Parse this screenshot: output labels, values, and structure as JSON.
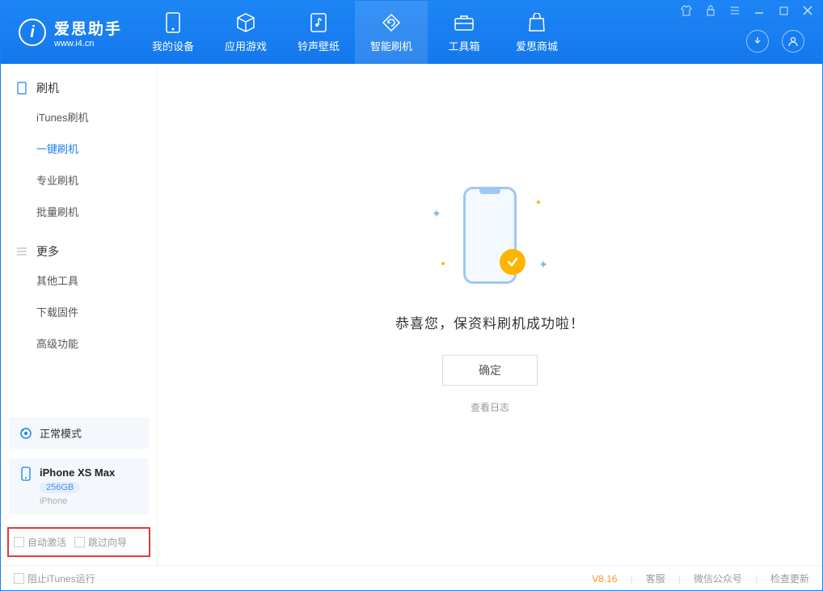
{
  "app": {
    "name": "爱思助手",
    "url": "www.i4.cn"
  },
  "nav": {
    "items": [
      {
        "label": "我的设备"
      },
      {
        "label": "应用游戏"
      },
      {
        "label": "铃声壁纸"
      },
      {
        "label": "智能刷机"
      },
      {
        "label": "工具箱"
      },
      {
        "label": "爱思商城"
      }
    ]
  },
  "sidebar": {
    "section1_title": "刷机",
    "section1_items": [
      "iTunes刷机",
      "一键刷机",
      "专业刷机",
      "批量刷机"
    ],
    "section2_title": "更多",
    "section2_items": [
      "其他工具",
      "下载固件",
      "高级功能"
    ]
  },
  "device": {
    "mode": "正常模式",
    "name": "iPhone XS Max",
    "storage": "256GB",
    "type": "iPhone"
  },
  "options": {
    "auto_activate": "自动激活",
    "skip_guide": "跳过向导"
  },
  "main": {
    "message": "恭喜您，保资料刷机成功啦！",
    "ok": "确定",
    "view_log": "查看日志"
  },
  "footer": {
    "block_itunes": "阻止iTunes运行",
    "version": "V8.16",
    "links": [
      "客服",
      "微信公众号",
      "检查更新"
    ]
  }
}
